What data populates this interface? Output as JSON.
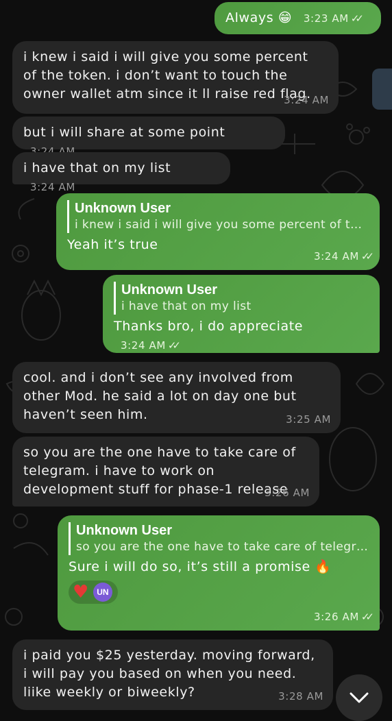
{
  "messages": [
    {
      "id": "m1",
      "dir": "out",
      "text": "Always 😁",
      "time": "3:23 AM",
      "read": true
    },
    {
      "id": "m2",
      "dir": "in",
      "text": "i knew i said i will give you some percent of the token. i don’t want to touch the owner wallet atm since it ll raise red flag.",
      "time": "3:24 AM"
    },
    {
      "id": "m3",
      "dir": "in",
      "text": "but i will share at some point",
      "time": "3:24 AM"
    },
    {
      "id": "m4",
      "dir": "in",
      "text": "i have that on my list",
      "time": "3:24 AM"
    },
    {
      "id": "m5",
      "dir": "out",
      "reply_to_name": "Unknown User",
      "reply_to_text": "i knew i said i will give you some percent of the...",
      "text": "Yeah it’s true",
      "time": "3:24 AM",
      "read": true
    },
    {
      "id": "m6",
      "dir": "out",
      "reply_to_name": "Unknown User",
      "reply_to_text": "i have that on my list",
      "text": "Thanks bro, i do appreciate",
      "time": "3:24 AM",
      "read": true
    },
    {
      "id": "m7",
      "dir": "in",
      "text": "cool. and i don’t see any involved from other Mod. he said a lot on day one but haven’t seen him.",
      "time": "3:25 AM"
    },
    {
      "id": "m8",
      "dir": "in",
      "text": "so you are the one have to take care of telegram. i have to work on  development stuff for phase-1 release",
      "time": "3:26 AM"
    },
    {
      "id": "m9",
      "dir": "out",
      "reply_to_name": "Unknown User",
      "reply_to_text": "so you are the one have to take care of telegra...",
      "text": "Sure i will do so, it’s still a promise 🔥",
      "time": "3:26 AM",
      "read": true,
      "reaction": "heart",
      "reaction_avatar": "UN"
    },
    {
      "id": "m10",
      "dir": "in",
      "text": "i paid you $25 yesterday. moving forward, i will pay you based on when you need. liike weekly or biweekly?",
      "time": "3:28 AM"
    }
  ],
  "colors": {
    "background": "#0e0e0e",
    "incoming": "#262626",
    "outgoing": "#5aa84d",
    "reaction_avatar": "#7b5bd6"
  },
  "icons": {
    "read_receipt": "double-check-icon",
    "scroll_down": "chevron-down-icon",
    "reaction": "heart-icon"
  }
}
